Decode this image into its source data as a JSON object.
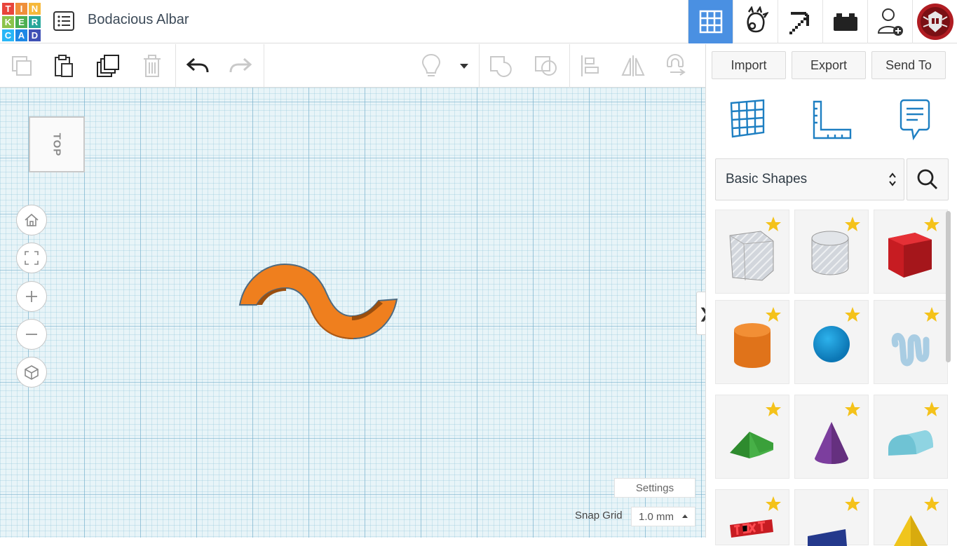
{
  "app": {
    "logo_letters": [
      "T",
      "I",
      "N",
      "K",
      "E",
      "R",
      "C",
      "A",
      "D"
    ],
    "logo_colors": [
      "#e8453c",
      "#ef8f3a",
      "#f6b93b",
      "#8bc34a",
      "#4caf50",
      "#26a69a",
      "#29b6f6",
      "#1e88e5",
      "#3f51b5"
    ],
    "document_title": "Bodacious Albar",
    "accent_color": "#4a90e2"
  },
  "topnav": {
    "items": [
      {
        "name": "3d-design-grid-icon",
        "active": true
      },
      {
        "name": "codeblocks-icon"
      },
      {
        "name": "minecraft-pickaxe-icon"
      },
      {
        "name": "lego-brick-icon"
      },
      {
        "name": "invite-user-icon"
      },
      {
        "name": "user-avatar"
      }
    ]
  },
  "toolbar": {
    "icons": [
      "copy-icon",
      "paste-icon",
      "duplicate-icon",
      "delete-icon",
      "undo-icon",
      "redo-icon",
      "lightbulb-icon",
      "dropdown-caret-icon",
      "group-icon",
      "ungroup-icon",
      "align-icon",
      "mirror-icon",
      "magnet-icon"
    ]
  },
  "panel": {
    "import_label": "Import",
    "export_label": "Export",
    "sendto_label": "Send To",
    "view_icons": [
      "workplane-grid-icon",
      "ruler-icon",
      "notes-icon"
    ],
    "category": "Basic Shapes",
    "shapes": [
      {
        "name": "box-hole-shape"
      },
      {
        "name": "cylinder-hole-shape"
      },
      {
        "name": "box-shape"
      },
      {
        "name": "cylinder-shape"
      },
      {
        "name": "sphere-shape"
      },
      {
        "name": "scribble-shape"
      },
      {
        "name": "roof-shape"
      },
      {
        "name": "cone-shape"
      },
      {
        "name": "round-roof-shape"
      },
      {
        "name": "text-shape"
      },
      {
        "name": "wedge-shape"
      },
      {
        "name": "pyramid-shape"
      }
    ]
  },
  "workplane": {
    "viewcube_label": "TOP",
    "settings_label": "Settings",
    "snap_label": "Snap Grid",
    "snap_value": "1.0 mm",
    "object_color": "#ef7f1e"
  }
}
